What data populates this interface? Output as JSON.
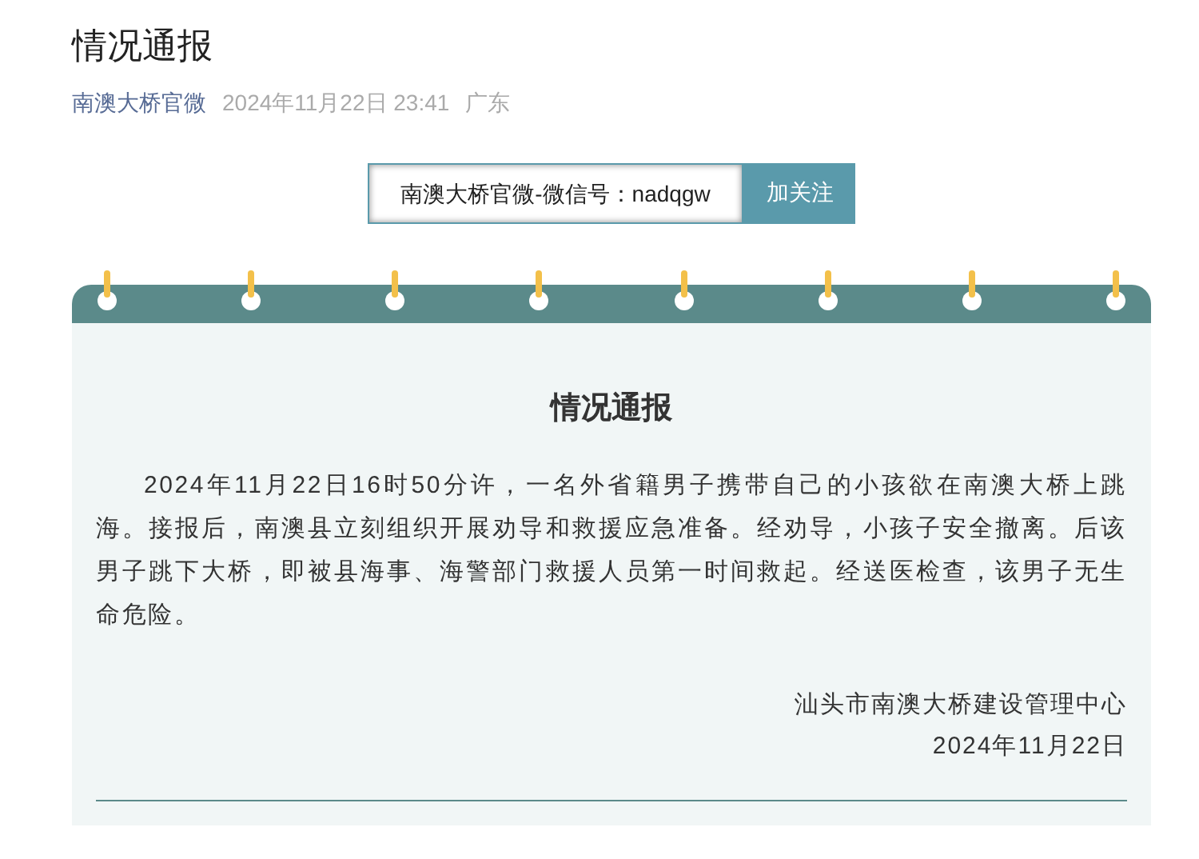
{
  "article": {
    "title": "情况通报",
    "account": "南澳大桥官微",
    "date": "2024年11月22日 23:41",
    "location": "广东"
  },
  "follow_box": {
    "text": "南澳大桥官微-微信号：nadqgw",
    "button": "加关注"
  },
  "notice": {
    "heading": "情况通报",
    "body": "2024年11月22日16时50分许，一名外省籍男子携带自己的小孩欲在南澳大桥上跳海。接报后，南澳县立刻组织开展劝导和救援应急准备。经劝导，小孩子安全撤离。后该男子跳下大桥，即被县海事、海警部门救援人员第一时间救起。经送医检查，该男子无生命危险。",
    "signature": "汕头市南澳大桥建设管理中心",
    "signature_date": "2024年11月22日"
  }
}
